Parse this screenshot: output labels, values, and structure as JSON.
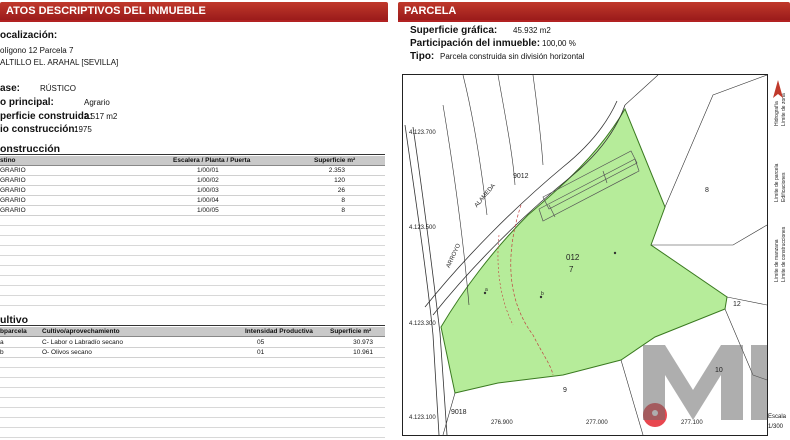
{
  "left_header": "ATOS DESCRIPTIVOS DEL INMUEBLE",
  "right_header": "PARCELA",
  "inmueble": {
    "localizacion_label": "ocalización:",
    "localizacion_line1": "olígono 12 Parcela 7",
    "localizacion_line2": "ALTILLO EL. ARAHAL [SEVILLA]",
    "clase_label": "ase:",
    "clase_value": "RÚSTICO",
    "uso_label": "o principal:",
    "uso_value": "Agrario",
    "superficie_label": "perficie construida:",
    "superficie_value": "2.517 m2",
    "anio_label": "io construcción:",
    "anio_value": "1975"
  },
  "construccion": {
    "title": "onstrucción",
    "headers": [
      "stino",
      "Escalera / Planta / Puerta",
      "Superficie m²"
    ],
    "rows": [
      {
        "destino": "GRARIO",
        "epp": "1/00/01",
        "superficie": "2.353"
      },
      {
        "destino": "GRARIO",
        "epp": "1/00/02",
        "superficie": "120"
      },
      {
        "destino": "GRARIO",
        "epp": "1/00/03",
        "superficie": "26"
      },
      {
        "destino": "GRARIO",
        "epp": "1/00/04",
        "superficie": "8"
      },
      {
        "destino": "GRARIO",
        "epp": "1/00/05",
        "superficie": "8"
      }
    ]
  },
  "cultivo": {
    "title": "ultivo",
    "headers": [
      "bparcela",
      "Cultivo/aprovechamiento",
      "Intensidad Productiva",
      "Superficie m²"
    ],
    "rows": [
      {
        "sub": "a",
        "cultivo": "C- Labor o Labradío secano",
        "intensidad": "05",
        "superficie": "30.973"
      },
      {
        "sub": "b",
        "cultivo": "O- Olivos secano",
        "intensidad": "01",
        "superficie": "10.961"
      }
    ]
  },
  "parcela": {
    "superficie_label": "Superficie gráfica:",
    "superficie_value": "45.932 m2",
    "participacion_label": "Participación del inmueble:",
    "participacion_value": "100,00 %",
    "tipo_label": "Tipo:",
    "tipo_value": "Parcela construida sin división horizontal"
  },
  "map": {
    "y_coords": [
      "4.123.700",
      "4.123.500",
      "4.123.300",
      "4.123.100"
    ],
    "x_coords": [
      "276.900",
      "277.000",
      "277.100"
    ],
    "road_labels": [
      "ALAMEDA",
      "ARROYO"
    ],
    "parcel_labels": [
      "9012",
      "012",
      "7",
      "8",
      "12",
      "10",
      "9",
      "9018"
    ],
    "subparcel_labels": [
      "a",
      "b"
    ],
    "legend": [
      "Hidrografía",
      "Límite de zona",
      "Límite de parcela",
      "Edificaciones",
      "Límite de manzana",
      "Límite de construcciones"
    ],
    "scale_label": "Escala",
    "scale_value": "1/300"
  },
  "colors": {
    "header": "#b22222",
    "parcel_fill": "#b6ec9a",
    "parcel_stroke": "#3a7a20",
    "pin": "#e8474f"
  }
}
